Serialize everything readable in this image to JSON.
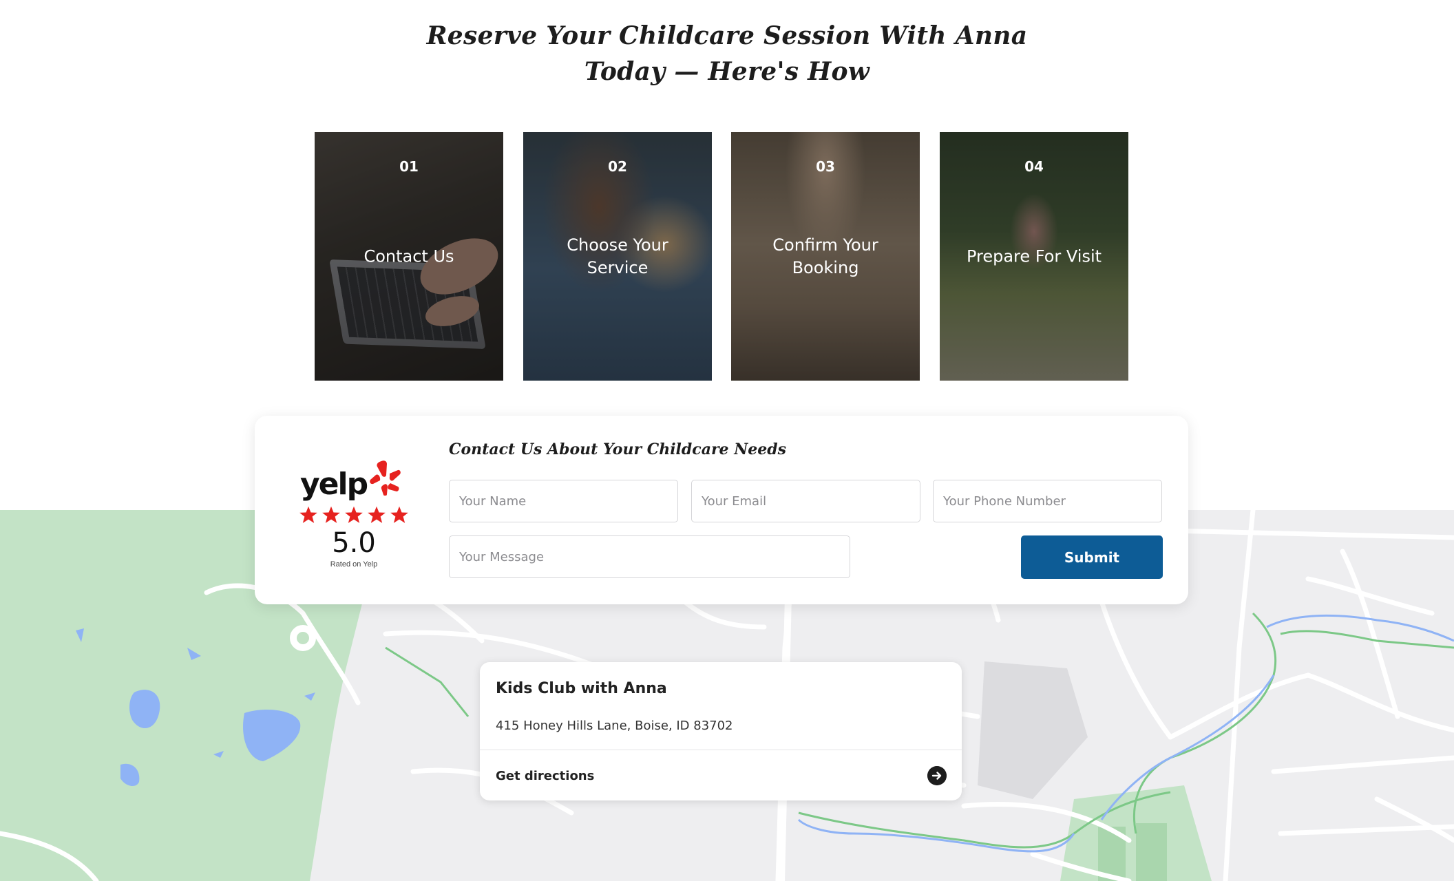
{
  "header": {
    "title_line1": "Reserve Your Childcare Session With Anna",
    "title_line2": "Today — Here's How"
  },
  "steps": [
    {
      "number": "01",
      "label": "Contact Us"
    },
    {
      "number": "02",
      "label": "Choose Your Service"
    },
    {
      "number": "03",
      "label": "Confirm Your Booking"
    },
    {
      "number": "04",
      "label": "Prepare For Visit"
    }
  ],
  "yelp": {
    "brand": "yelp",
    "score": "5.0",
    "rated_text": "Rated on Yelp",
    "star_color": "#e6221f"
  },
  "contact_form": {
    "title": "Contact Us About Your Childcare Needs",
    "name_placeholder": "Your Name",
    "email_placeholder": "Your Email",
    "phone_placeholder": "Your Phone Number",
    "message_placeholder": "Your Message",
    "submit_label": "Submit",
    "submit_color": "#0d5c96"
  },
  "location": {
    "name": "Kids Club with Anna",
    "address": "415 Honey Hills Lane, Boise, ID 83702",
    "directions_label": "Get directions"
  },
  "icons": {
    "yelp_burst": "yelp-burst-icon",
    "star": "star-icon",
    "directions_arrow": "arrow-right-circle-icon"
  }
}
